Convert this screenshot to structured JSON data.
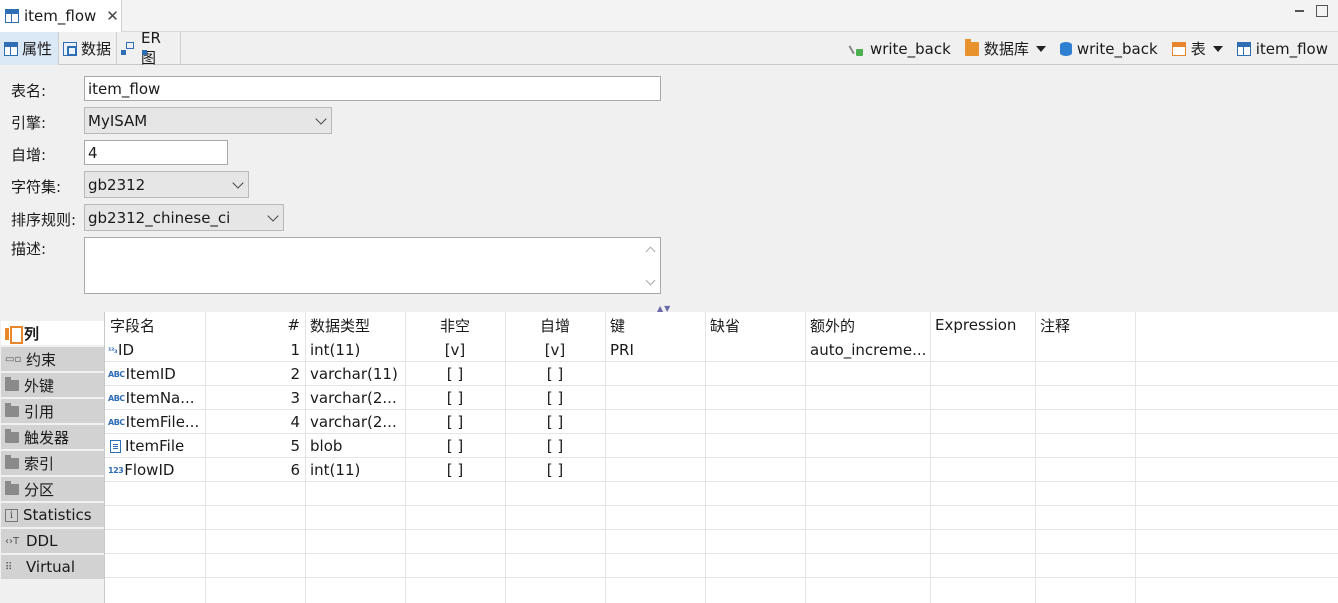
{
  "editor_tab": {
    "title": "item_flow"
  },
  "subtabs": [
    {
      "label": "属性"
    },
    {
      "label": "数据"
    },
    {
      "label": "ER 图"
    }
  ],
  "breadcrumbs": {
    "connection": "write_back",
    "db_folder": "数据库",
    "database": "write_back",
    "table_folder": "表",
    "table": "item_flow"
  },
  "properties": {
    "name_label": "表名:",
    "name_value": "item_flow",
    "engine_label": "引擎:",
    "engine_value": "MyISAM",
    "autoinc_label": "自增:",
    "autoinc_value": "4",
    "charset_label": "字符集:",
    "charset_value": "gb2312",
    "collation_label": "排序规则:",
    "collation_value": "gb2312_chinese_ci",
    "desc_label": "描述:"
  },
  "left_tabs": [
    "列",
    "约束",
    "外键",
    "引用",
    "触发器",
    "索引",
    "分区",
    "Statistics",
    "DDL",
    "Virtual"
  ],
  "columns_header": [
    "字段名",
    "#",
    "数据类型",
    "非空",
    "自增",
    "键",
    "缺省",
    "额外的",
    "Expression",
    "注释"
  ],
  "rows": [
    {
      "icon": "123",
      "name": "ID",
      "num": "1",
      "type": "int(11)",
      "notnull": "[v]",
      "autoinc": "[v]",
      "key": "PRI",
      "default": "",
      "extra": "auto_increme...",
      "expr": "",
      "comment": ""
    },
    {
      "icon": "ABC",
      "name": "ItemID",
      "num": "2",
      "type": "varchar(11)",
      "notnull": "[ ]",
      "autoinc": "[ ]",
      "key": "",
      "default": "",
      "extra": "",
      "expr": "",
      "comment": ""
    },
    {
      "icon": "ABC",
      "name": "ItemNa...",
      "num": "3",
      "type": "varchar(2...",
      "notnull": "[ ]",
      "autoinc": "[ ]",
      "key": "",
      "default": "",
      "extra": "",
      "expr": "",
      "comment": ""
    },
    {
      "icon": "ABC",
      "name": "ItemFile...",
      "num": "4",
      "type": "varchar(2...",
      "notnull": "[ ]",
      "autoinc": "[ ]",
      "key": "",
      "default": "",
      "extra": "",
      "expr": "",
      "comment": ""
    },
    {
      "icon": "blob",
      "name": "ItemFile",
      "num": "5",
      "type": "blob",
      "notnull": "[ ]",
      "autoinc": "[ ]",
      "key": "",
      "default": "",
      "extra": "",
      "expr": "",
      "comment": ""
    },
    {
      "icon": "123",
      "name": "FlowID",
      "num": "6",
      "type": "int(11)",
      "notnull": "[ ]",
      "autoinc": "[ ]",
      "key": "",
      "default": "",
      "extra": "",
      "expr": "",
      "comment": ""
    }
  ]
}
